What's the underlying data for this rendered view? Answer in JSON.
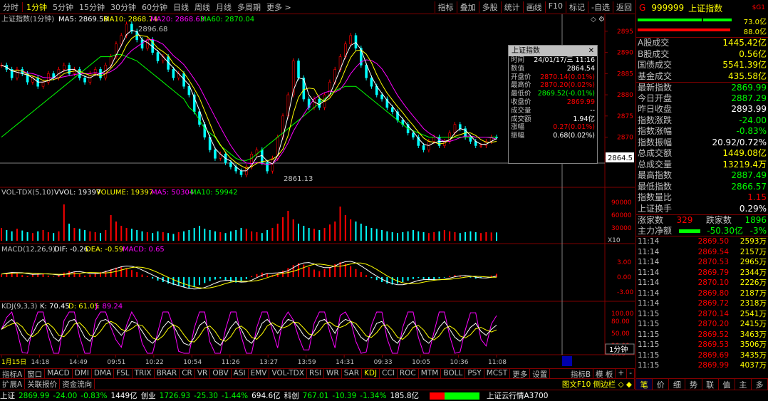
{
  "toolbar": {
    "periods": [
      "分时",
      "1分钟",
      "5分钟",
      "15分钟",
      "30分钟",
      "60分钟",
      "日线",
      "周线",
      "月线",
      "多周期",
      "更多 >"
    ],
    "selected": "1分钟",
    "right": [
      "指标",
      "叠加",
      "多股",
      "统计",
      "画线",
      "F10",
      "标记",
      "-自选",
      "返回"
    ]
  },
  "main_legend": {
    "title": "上证指数(1分钟)",
    "ma5": "MA5: 2869.58",
    "ma10": "MA10: 2868.74",
    "ma20": "MA20: 2868.63",
    "ma60": "MA60: 2870.04"
  },
  "price_axis": [
    "2895",
    "2890",
    "2885",
    "2880",
    "2875",
    "2870",
    "2865"
  ],
  "price_marker": "2864.5",
  "high_label": "2896.68",
  "low_label": "2861.13",
  "vol_legend": {
    "name": "VOL-TDX(5,10)",
    "vvol": "VVOL: 19397",
    "volume": "VOLUME: 19397",
    "ma5": "MA5: 50304",
    "ma10": "MA10: 59942"
  },
  "vol_axis": [
    "90000",
    "60000",
    "30000"
  ],
  "vol_mult": "X10",
  "macd_legend": {
    "name": "MACD(12,26,9)",
    "dif": "DIF: -0.26",
    "dea": "DEA: -0.59",
    "macd": "MACD: 0.65"
  },
  "macd_axis": [
    "3.00",
    "0.00",
    "-3.00"
  ],
  "kdj_legend": {
    "name": "KDJ(9,3,3)",
    "k": "K: 70.45",
    "d": "D: 61.05",
    "j": "J: 89.24"
  },
  "kdj_axis": [
    "100.00",
    "80.00",
    "50.00",
    "20.00",
    "0.00"
  ],
  "period_button": "1分钟",
  "time_axis": [
    "1月15日",
    "14:18",
    "14:49",
    "09:51",
    "10:22",
    "10:54",
    "11:26",
    "13:27",
    "13:59",
    "14:31",
    "09:33",
    "10:05",
    "10:36",
    "11:08"
  ],
  "indicators": [
    "指标A",
    "窗口",
    "MACD",
    "DMI",
    "DMA",
    "FSL",
    "TRIX",
    "BRAR",
    "CR",
    "VR",
    "OBV",
    "ASI",
    "EMV",
    "VOL-TDX",
    "RSI",
    "WR",
    "SAR",
    "KDJ",
    "CCI",
    "ROC",
    "MTM",
    "BOLL",
    "PSY",
    "MCST",
    "更多",
    "设置"
  ],
  "indicator_selected": "KDJ",
  "indicator_right": [
    "指标B",
    "模 板",
    "+",
    "-"
  ],
  "tabs2": [
    "扩展A",
    "关联报价",
    "资金流向"
  ],
  "tabs2_right": "图文F10 侧边栏 ◇ ◆",
  "popup": {
    "title": "上证指数",
    "rows": [
      {
        "k": "时间",
        "v": "24/01/17/三 11:16",
        "c": "wht"
      },
      {
        "k": "数值",
        "v": "2864.54",
        "c": "wht"
      },
      {
        "k": "开盘价",
        "v": "2870.14(0.01%)",
        "c": "red"
      },
      {
        "k": "最高价",
        "v": "2870.20(0.02%)",
        "c": "red"
      },
      {
        "k": "最低价",
        "v": "2869.52(-0.01%)",
        "c": "grn"
      },
      {
        "k": "收盘价",
        "v": "2869.99",
        "c": "red"
      },
      {
        "k": "成交量",
        "v": "--",
        "c": "wht"
      },
      {
        "k": "成交额",
        "v": "1.94亿",
        "c": "wht"
      },
      {
        "k": "涨幅",
        "v": "0.27(0.01%)",
        "c": "red"
      },
      {
        "k": "振幅",
        "v": "0.68(0.02%)",
        "c": "wht"
      }
    ]
  },
  "right_panel": {
    "header_g": "G",
    "code": "999999",
    "name": "上证指数",
    "tag": "$G1",
    "pct_top": "73.0亿",
    "pct_bottom": "88.0亿",
    "stats": [
      {
        "k": "A股成交",
        "v": "1445.42亿",
        "c": "yel"
      },
      {
        "k": "B股成交",
        "v": "0.56亿",
        "c": "yel"
      },
      {
        "k": "国债成交",
        "v": "5541.39亿",
        "c": "yel"
      },
      {
        "k": "基金成交",
        "v": "435.58亿",
        "c": "yel"
      },
      {
        "k": "最新指数",
        "v": "2869.99",
        "c": "grn"
      },
      {
        "k": "今日开盘",
        "v": "2887.29",
        "c": "grn"
      },
      {
        "k": "昨日收盘",
        "v": "2893.99",
        "c": "wht"
      },
      {
        "k": "指数涨跌",
        "v": "-24.00",
        "c": "grn"
      },
      {
        "k": "指数涨幅",
        "v": "-0.83%",
        "c": "grn"
      },
      {
        "k": "指数振幅",
        "v": "20.92/0.72%",
        "c": "wht"
      },
      {
        "k": "总成交额",
        "v": "1449.08亿",
        "c": "yel"
      },
      {
        "k": "总成交量",
        "v": "13219.4万",
        "c": "yel"
      },
      {
        "k": "最高指数",
        "v": "2887.49",
        "c": "grn"
      },
      {
        "k": "最低指数",
        "v": "2866.57",
        "c": "grn"
      },
      {
        "k": "指数量比",
        "v": "1.15",
        "c": "red"
      },
      {
        "k": "上证换手",
        "v": "0.29%",
        "c": "wht"
      }
    ],
    "up_label": "涨家数",
    "up": "329",
    "down_label": "跌家数",
    "down": "1896",
    "flow_label": "主力净额",
    "flow": "-50.30亿",
    "flow_pct": "-3%",
    "ticks": [
      {
        "t": "11:14",
        "p": "2869.50",
        "v": "2593万"
      },
      {
        "t": "11:14",
        "p": "2869.54",
        "v": "2157万"
      },
      {
        "t": "11:14",
        "p": "2870.53",
        "v": "2965万"
      },
      {
        "t": "11:14",
        "p": "2869.79",
        "v": "2344万"
      },
      {
        "t": "11:14",
        "p": "2870.10",
        "v": "2226万"
      },
      {
        "t": "11:14",
        "p": "2869.80",
        "v": "2187万"
      },
      {
        "t": "11:14",
        "p": "2869.72",
        "v": "2318万"
      },
      {
        "t": "11:15",
        "p": "2870.14",
        "v": "2541万"
      },
      {
        "t": "11:15",
        "p": "2870.20",
        "v": "2415万"
      },
      {
        "t": "11:15",
        "p": "2869.52",
        "v": "3463万"
      },
      {
        "t": "11:15",
        "p": "2869.53",
        "v": "3506万"
      },
      {
        "t": "11:15",
        "p": "2869.69",
        "v": "3435万"
      },
      {
        "t": "11:15",
        "p": "2869.99",
        "v": "4037万"
      }
    ],
    "bottom_tabs": [
      "笔",
      "价",
      "细",
      "势",
      "联",
      "值",
      "主",
      "多"
    ],
    "bottom_selected": "笔"
  },
  "status": [
    {
      "t": "上证",
      "c": "wht"
    },
    {
      "t": "2869.99",
      "c": "grn"
    },
    {
      "t": "-24.00",
      "c": "grn"
    },
    {
      "t": "-0.83%",
      "c": "grn"
    },
    {
      "t": "1449亿",
      "c": "wht"
    },
    {
      "t": "创业",
      "c": "wht"
    },
    {
      "t": "1726.93",
      "c": "grn"
    },
    {
      "t": "-25.30",
      "c": "grn"
    },
    {
      "t": "-1.44%",
      "c": "grn"
    },
    {
      "t": "694.6亿",
      "c": "wht"
    },
    {
      "t": "科创",
      "c": "wht"
    },
    {
      "t": "767.01",
      "c": "grn"
    },
    {
      "t": "-10.39",
      "c": "grn"
    },
    {
      "t": "-1.34%",
      "c": "grn"
    },
    {
      "t": "185.8亿",
      "c": "wht"
    },
    {
      "t": "上证云行情A3700",
      "c": "wht"
    }
  ],
  "chart_data": {
    "type": "line",
    "title": "上证指数(1分钟)",
    "ylim": [
      2860,
      2897
    ],
    "close": [
      2887,
      2886,
      2884,
      2886,
      2885,
      2883,
      2884,
      2882,
      2883,
      2885,
      2884,
      2886,
      2887,
      2885,
      2886,
      2884,
      2883,
      2885,
      2886,
      2884,
      2887,
      2889,
      2892,
      2894,
      2896.68,
      2895,
      2893,
      2891,
      2893,
      2890,
      2888,
      2889,
      2886,
      2884,
      2885,
      2882,
      2880,
      2876,
      2873,
      2870,
      2867,
      2865,
      2866,
      2864,
      2863,
      2862,
      2861.13,
      2863,
      2866,
      2867,
      2864,
      2862,
      2865,
      2870,
      2875,
      2880,
      2888,
      2884,
      2879,
      2877,
      2879,
      2877,
      2880,
      2883,
      2886,
      2889,
      2892,
      2894,
      2891,
      2887,
      2884,
      2882,
      2880,
      2879,
      2877,
      2876,
      2874,
      2873,
      2871,
      2870,
      2868,
      2867,
      2869,
      2870,
      2868,
      2869,
      2871,
      2873,
      2872,
      2870,
      2869,
      2868,
      2868,
      2869,
      2870,
      2869.99
    ],
    "ma60": [
      2870,
      2871,
      2872,
      2873,
      2874,
      2875,
      2876,
      2877,
      2878,
      2879,
      2880,
      2881,
      2882,
      2883,
      2884,
      2885,
      2886,
      2887,
      2888,
      2889,
      2889,
      2889,
      2889.5,
      2889.5,
      2889,
      2888.5,
      2888,
      2887,
      2886,
      2885,
      2884,
      2883,
      2882,
      2881,
      2880,
      2879,
      2877,
      2876,
      2874,
      2872,
      2871,
      2870,
      2868,
      2867,
      2866,
      2865,
      2864.5,
      2864.5,
      2865,
      2866,
      2867,
      2868,
      2869,
      2870,
      2871,
      2872,
      2873,
      2874,
      2875,
      2876,
      2877,
      2878,
      2879,
      2880,
      2881,
      2881.5,
      2882,
      2882,
      2882,
      2881,
      2880,
      2879,
      2878,
      2877,
      2876,
      2875,
      2874,
      2873,
      2872,
      2871.5,
      2871,
      2870.5,
      2870,
      2870,
      2870,
      2870,
      2870,
      2870,
      2870,
      2870,
      2870,
      2870,
      2870,
      2870,
      2870,
      2870.04
    ],
    "volume": [
      30,
      25,
      22,
      28,
      24,
      20,
      18,
      22,
      25,
      20,
      18,
      22,
      85,
      40,
      30,
      28,
      25,
      22,
      20,
      18,
      25,
      60,
      45,
      35,
      30,
      28,
      25,
      22,
      20,
      18,
      22,
      20,
      18,
      16,
      20,
      22,
      25,
      30,
      35,
      28,
      25,
      22,
      20,
      18,
      22,
      25,
      30,
      28,
      22,
      20,
      18,
      25,
      30,
      40,
      55,
      70,
      50,
      40,
      35,
      30,
      28,
      25,
      30,
      38,
      45,
      80,
      60,
      50,
      45,
      40,
      35,
      30,
      28,
      25,
      22,
      20,
      18,
      20,
      22,
      25,
      22,
      20,
      18,
      20,
      22,
      25,
      22,
      20,
      18,
      20,
      22,
      20,
      18,
      20,
      19.4,
      19.4
    ],
    "macd": [
      0.5,
      0.8,
      1.0,
      0.7,
      0.4,
      0.2,
      0.5,
      0.8,
      0.6,
      0.3,
      0.1,
      0.4,
      0.9,
      1.2,
      1.0,
      0.6,
      0.3,
      0.5,
      0.8,
      1.0,
      1.3,
      1.6,
      1.9,
      2.1,
      1.8,
      1.4,
      1.0,
      0.5,
      0.2,
      -0.3,
      -0.7,
      -1.0,
      -1.3,
      -1.6,
      -1.8,
      -2.0,
      -2.2,
      -2.0,
      -1.6,
      -1.2,
      -0.8,
      -0.5,
      -0.3,
      -0.6,
      -0.9,
      -1.1,
      -0.8,
      -0.4,
      0.2,
      0.6,
      0.9,
      0.7,
      0.4,
      0.8,
      1.3,
      1.8,
      2.4,
      2.8,
      2.5,
      2.0,
      1.5,
      1.2,
      1.6,
      2.0,
      2.6,
      3.0,
      2.7,
      2.2,
      1.6,
      1.0,
      0.4,
      -0.2,
      -0.6,
      -1.0,
      -1.3,
      -1.5,
      -1.3,
      -1.0,
      -0.7,
      -0.4,
      -0.2,
      -0.4,
      -0.6,
      -0.5,
      -0.3,
      -0.1,
      0.2,
      0.4,
      0.3,
      0.1,
      -0.1,
      -0.3,
      -0.2,
      0.0,
      0.3,
      0.65
    ],
    "kdj_k": [
      60,
      75,
      85,
      70,
      45,
      30,
      50,
      75,
      85,
      65,
      40,
      30,
      55,
      80,
      85,
      65,
      40,
      30,
      55,
      80,
      85,
      75,
      60,
      45,
      60,
      80,
      75,
      55,
      35,
      25,
      40,
      65,
      80,
      70,
      45,
      25,
      20,
      40,
      70,
      80,
      55,
      30,
      20,
      40,
      65,
      80,
      60,
      35,
      25,
      45,
      75,
      85,
      70,
      50,
      70,
      85,
      80,
      65,
      45,
      35,
      55,
      80,
      85,
      70,
      50,
      75,
      85,
      80,
      60,
      40,
      30,
      50,
      75,
      80,
      60,
      35,
      25,
      45,
      70,
      80,
      60,
      35,
      25,
      40,
      65,
      80,
      60,
      40,
      30,
      45,
      65,
      75,
      55,
      45,
      60,
      70.45
    ]
  }
}
